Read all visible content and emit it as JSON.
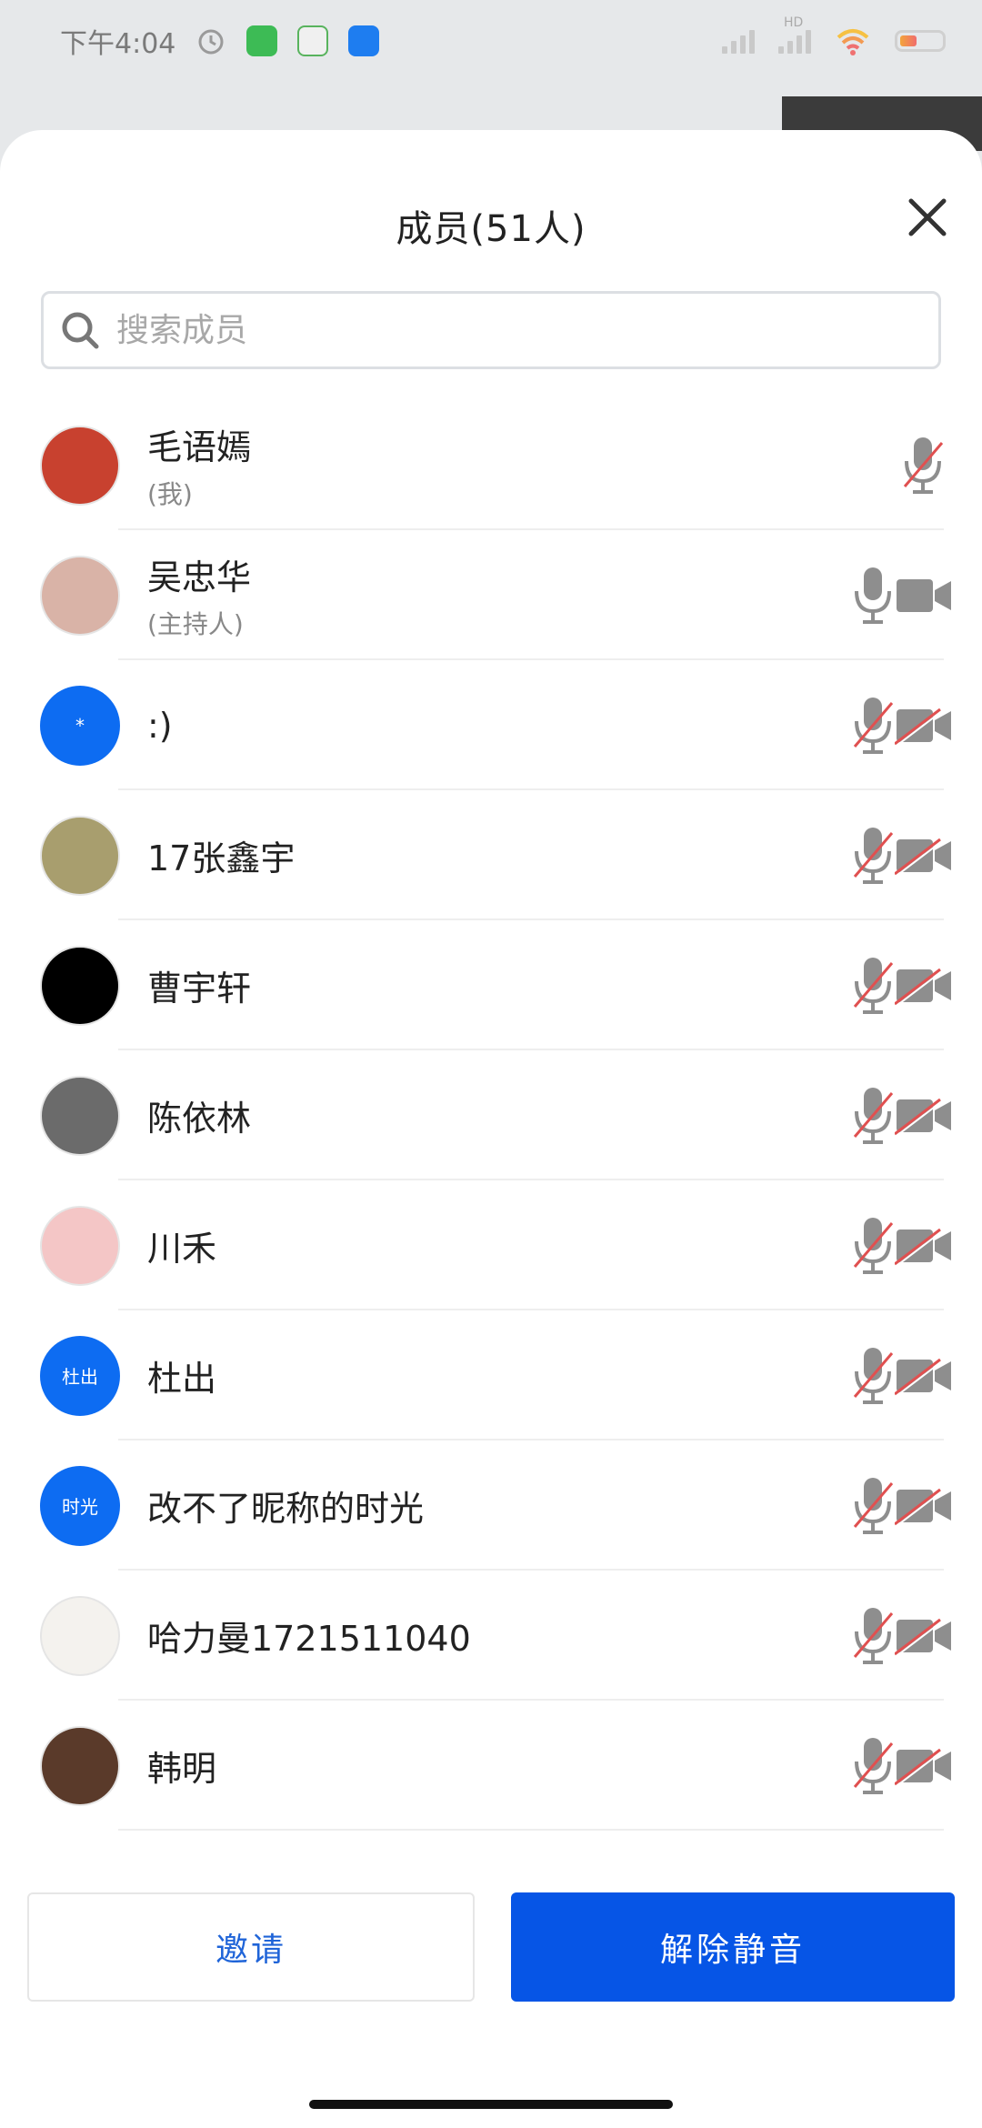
{
  "status_bar": {
    "time": "下午4:04",
    "hd_label": "HD"
  },
  "sheet": {
    "title": "成员(51人)",
    "search_placeholder": "搜索成员"
  },
  "members": [
    {
      "name": "毛语嫣",
      "sub": "(我)",
      "avatar_text": "",
      "avatar_color": "#c8412f",
      "mic_muted": true,
      "camera": "none"
    },
    {
      "name": "吴忠华",
      "sub": "(主持人)",
      "avatar_text": "",
      "avatar_color": "#d9b3a7",
      "mic_muted": false,
      "camera": "on"
    },
    {
      "name": ":)",
      "sub": "",
      "avatar_text": "*",
      "avatar_color": "#0d6cf2",
      "mic_muted": true,
      "camera": "off"
    },
    {
      "name": "17张鑫宇",
      "sub": "",
      "avatar_text": "",
      "avatar_color": "#a89e6e",
      "mic_muted": true,
      "camera": "off"
    },
    {
      "name": "曹宇轩",
      "sub": "",
      "avatar_text": "",
      "avatar_color": "#000000",
      "mic_muted": true,
      "camera": "off"
    },
    {
      "name": "陈依林",
      "sub": "",
      "avatar_text": "",
      "avatar_color": "#6b6b6b",
      "mic_muted": true,
      "camera": "off"
    },
    {
      "name": "川禾",
      "sub": "",
      "avatar_text": "",
      "avatar_color": "#f4c6c6",
      "mic_muted": true,
      "camera": "off"
    },
    {
      "name": "杜出",
      "sub": "",
      "avatar_text": "杜出",
      "avatar_color": "#0d6cf2",
      "mic_muted": true,
      "camera": "off"
    },
    {
      "name": "改不了昵称的时光",
      "sub": "",
      "avatar_text": "时光",
      "avatar_color": "#0d6cf2",
      "mic_muted": true,
      "camera": "off"
    },
    {
      "name": "哈力曼1721511040",
      "sub": "",
      "avatar_text": "",
      "avatar_color": "#f4f2ee",
      "mic_muted": true,
      "camera": "off"
    },
    {
      "name": "韩明",
      "sub": "",
      "avatar_text": "",
      "avatar_color": "#5a3a2a",
      "mic_muted": true,
      "camera": "off"
    }
  ],
  "actions": {
    "invite_label": "邀请",
    "unmute_label": "解除静音"
  },
  "colors": {
    "primary": "#0655e6",
    "muted_slash": "#e05050",
    "icon_gray": "#8e8e8e"
  }
}
